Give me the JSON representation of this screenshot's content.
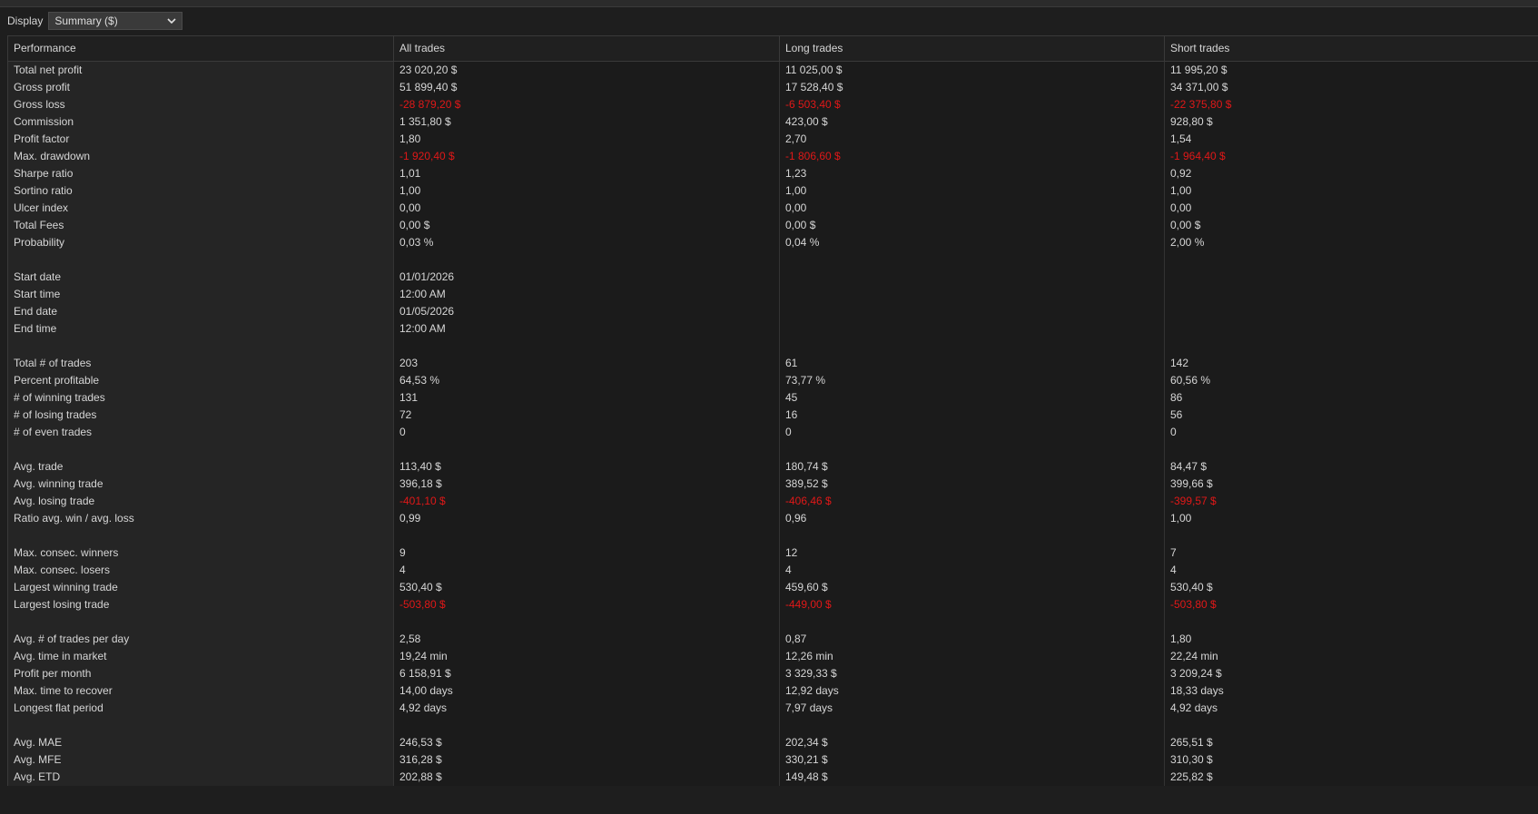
{
  "display": {
    "label": "Display",
    "selected": "Summary ($)"
  },
  "colors": {
    "negative": "#e01818",
    "background": "#1e1e1e"
  },
  "table": {
    "columns": [
      "Performance",
      "All trades",
      "Long trades",
      "Short trades"
    ],
    "rows": [
      {
        "label": "Total net profit",
        "values": [
          "23 020,20 $",
          "11 025,00 $",
          "11 995,20 $"
        ],
        "neg": [
          false,
          false,
          false
        ]
      },
      {
        "label": "Gross profit",
        "values": [
          "51 899,40 $",
          "17 528,40 $",
          "34 371,00 $"
        ],
        "neg": [
          false,
          false,
          false
        ]
      },
      {
        "label": "Gross loss",
        "values": [
          "-28 879,20 $",
          "-6 503,40 $",
          "-22 375,80 $"
        ],
        "neg": [
          true,
          true,
          true
        ]
      },
      {
        "label": "Commission",
        "values": [
          "1 351,80 $",
          "423,00 $",
          "928,80 $"
        ],
        "neg": [
          false,
          false,
          false
        ]
      },
      {
        "label": "Profit factor",
        "values": [
          "1,80",
          "2,70",
          "1,54"
        ],
        "neg": [
          false,
          false,
          false
        ]
      },
      {
        "label": "Max. drawdown",
        "values": [
          "-1 920,40 $",
          "-1 806,60 $",
          "-1 964,40 $"
        ],
        "neg": [
          true,
          true,
          true
        ]
      },
      {
        "label": "Sharpe ratio",
        "values": [
          "1,01",
          "1,23",
          "0,92"
        ],
        "neg": [
          false,
          false,
          false
        ]
      },
      {
        "label": "Sortino ratio",
        "values": [
          "1,00",
          "1,00",
          "1,00"
        ],
        "neg": [
          false,
          false,
          false
        ]
      },
      {
        "label": "Ulcer index",
        "values": [
          "0,00",
          "0,00",
          "0,00"
        ],
        "neg": [
          false,
          false,
          false
        ]
      },
      {
        "label": "Total Fees",
        "values": [
          "0,00 $",
          "0,00 $",
          "0,00 $"
        ],
        "neg": [
          false,
          false,
          false
        ]
      },
      {
        "label": "Probability",
        "values": [
          "0,03 %",
          "0,04 %",
          "2,00 %"
        ],
        "neg": [
          false,
          false,
          false
        ]
      },
      {
        "label": "",
        "values": [
          "",
          "",
          ""
        ],
        "neg": [
          false,
          false,
          false
        ]
      },
      {
        "label": "Start date",
        "values": [
          "01/01/2026",
          "",
          ""
        ],
        "neg": [
          false,
          false,
          false
        ]
      },
      {
        "label": "Start time",
        "values": [
          "12:00 AM",
          "",
          ""
        ],
        "neg": [
          false,
          false,
          false
        ]
      },
      {
        "label": "End date",
        "values": [
          "01/05/2026",
          "",
          ""
        ],
        "neg": [
          false,
          false,
          false
        ]
      },
      {
        "label": "End time",
        "values": [
          "12:00 AM",
          "",
          ""
        ],
        "neg": [
          false,
          false,
          false
        ]
      },
      {
        "label": "",
        "values": [
          "",
          "",
          ""
        ],
        "neg": [
          false,
          false,
          false
        ]
      },
      {
        "label": "Total # of trades",
        "values": [
          "203",
          "61",
          "142"
        ],
        "neg": [
          false,
          false,
          false
        ]
      },
      {
        "label": "Percent profitable",
        "values": [
          "64,53 %",
          "73,77 %",
          "60,56 %"
        ],
        "neg": [
          false,
          false,
          false
        ]
      },
      {
        "label": "# of winning trades",
        "values": [
          "131",
          "45",
          "86"
        ],
        "neg": [
          false,
          false,
          false
        ]
      },
      {
        "label": "# of losing trades",
        "values": [
          "72",
          "16",
          "56"
        ],
        "neg": [
          false,
          false,
          false
        ]
      },
      {
        "label": "# of even trades",
        "values": [
          "0",
          "0",
          "0"
        ],
        "neg": [
          false,
          false,
          false
        ]
      },
      {
        "label": "",
        "values": [
          "",
          "",
          ""
        ],
        "neg": [
          false,
          false,
          false
        ]
      },
      {
        "label": "Avg. trade",
        "values": [
          "113,40 $",
          "180,74 $",
          "84,47 $"
        ],
        "neg": [
          false,
          false,
          false
        ]
      },
      {
        "label": "Avg. winning trade",
        "values": [
          "396,18 $",
          "389,52 $",
          "399,66 $"
        ],
        "neg": [
          false,
          false,
          false
        ]
      },
      {
        "label": "Avg. losing trade",
        "values": [
          "-401,10 $",
          "-406,46 $",
          "-399,57 $"
        ],
        "neg": [
          true,
          true,
          true
        ]
      },
      {
        "label": "Ratio avg. win / avg. loss",
        "values": [
          "0,99",
          "0,96",
          "1,00"
        ],
        "neg": [
          false,
          false,
          false
        ]
      },
      {
        "label": "",
        "values": [
          "",
          "",
          ""
        ],
        "neg": [
          false,
          false,
          false
        ]
      },
      {
        "label": "Max. consec. winners",
        "values": [
          "9",
          "12",
          "7"
        ],
        "neg": [
          false,
          false,
          false
        ]
      },
      {
        "label": "Max. consec. losers",
        "values": [
          "4",
          "4",
          "4"
        ],
        "neg": [
          false,
          false,
          false
        ]
      },
      {
        "label": "Largest winning trade",
        "values": [
          "530,40 $",
          "459,60 $",
          "530,40 $"
        ],
        "neg": [
          false,
          false,
          false
        ]
      },
      {
        "label": "Largest losing trade",
        "values": [
          "-503,80 $",
          "-449,00 $",
          "-503,80 $"
        ],
        "neg": [
          true,
          true,
          true
        ]
      },
      {
        "label": "",
        "values": [
          "",
          "",
          ""
        ],
        "neg": [
          false,
          false,
          false
        ]
      },
      {
        "label": "Avg. # of trades per day",
        "values": [
          "2,58",
          "0,87",
          "1,80"
        ],
        "neg": [
          false,
          false,
          false
        ]
      },
      {
        "label": "Avg. time in market",
        "values": [
          "19,24 min",
          "12,26 min",
          "22,24 min"
        ],
        "neg": [
          false,
          false,
          false
        ]
      },
      {
        "label": "Profit per month",
        "values": [
          "6 158,91 $",
          "3 329,33 $",
          "3 209,24 $"
        ],
        "neg": [
          false,
          false,
          false
        ]
      },
      {
        "label": "Max. time to recover",
        "values": [
          "14,00 days",
          "12,92 days",
          "18,33 days"
        ],
        "neg": [
          false,
          false,
          false
        ]
      },
      {
        "label": "Longest flat period",
        "values": [
          "4,92 days",
          "7,97 days",
          "4,92 days"
        ],
        "neg": [
          false,
          false,
          false
        ]
      },
      {
        "label": "",
        "values": [
          "",
          "",
          ""
        ],
        "neg": [
          false,
          false,
          false
        ]
      },
      {
        "label": "Avg. MAE",
        "values": [
          "246,53 $",
          "202,34 $",
          "265,51 $"
        ],
        "neg": [
          false,
          false,
          false
        ]
      },
      {
        "label": "Avg. MFE",
        "values": [
          "316,28 $",
          "330,21 $",
          "310,30 $"
        ],
        "neg": [
          false,
          false,
          false
        ]
      },
      {
        "label": "Avg. ETD",
        "values": [
          "202,88 $",
          "149,48 $",
          "225,82 $"
        ],
        "neg": [
          false,
          false,
          false
        ]
      }
    ]
  }
}
